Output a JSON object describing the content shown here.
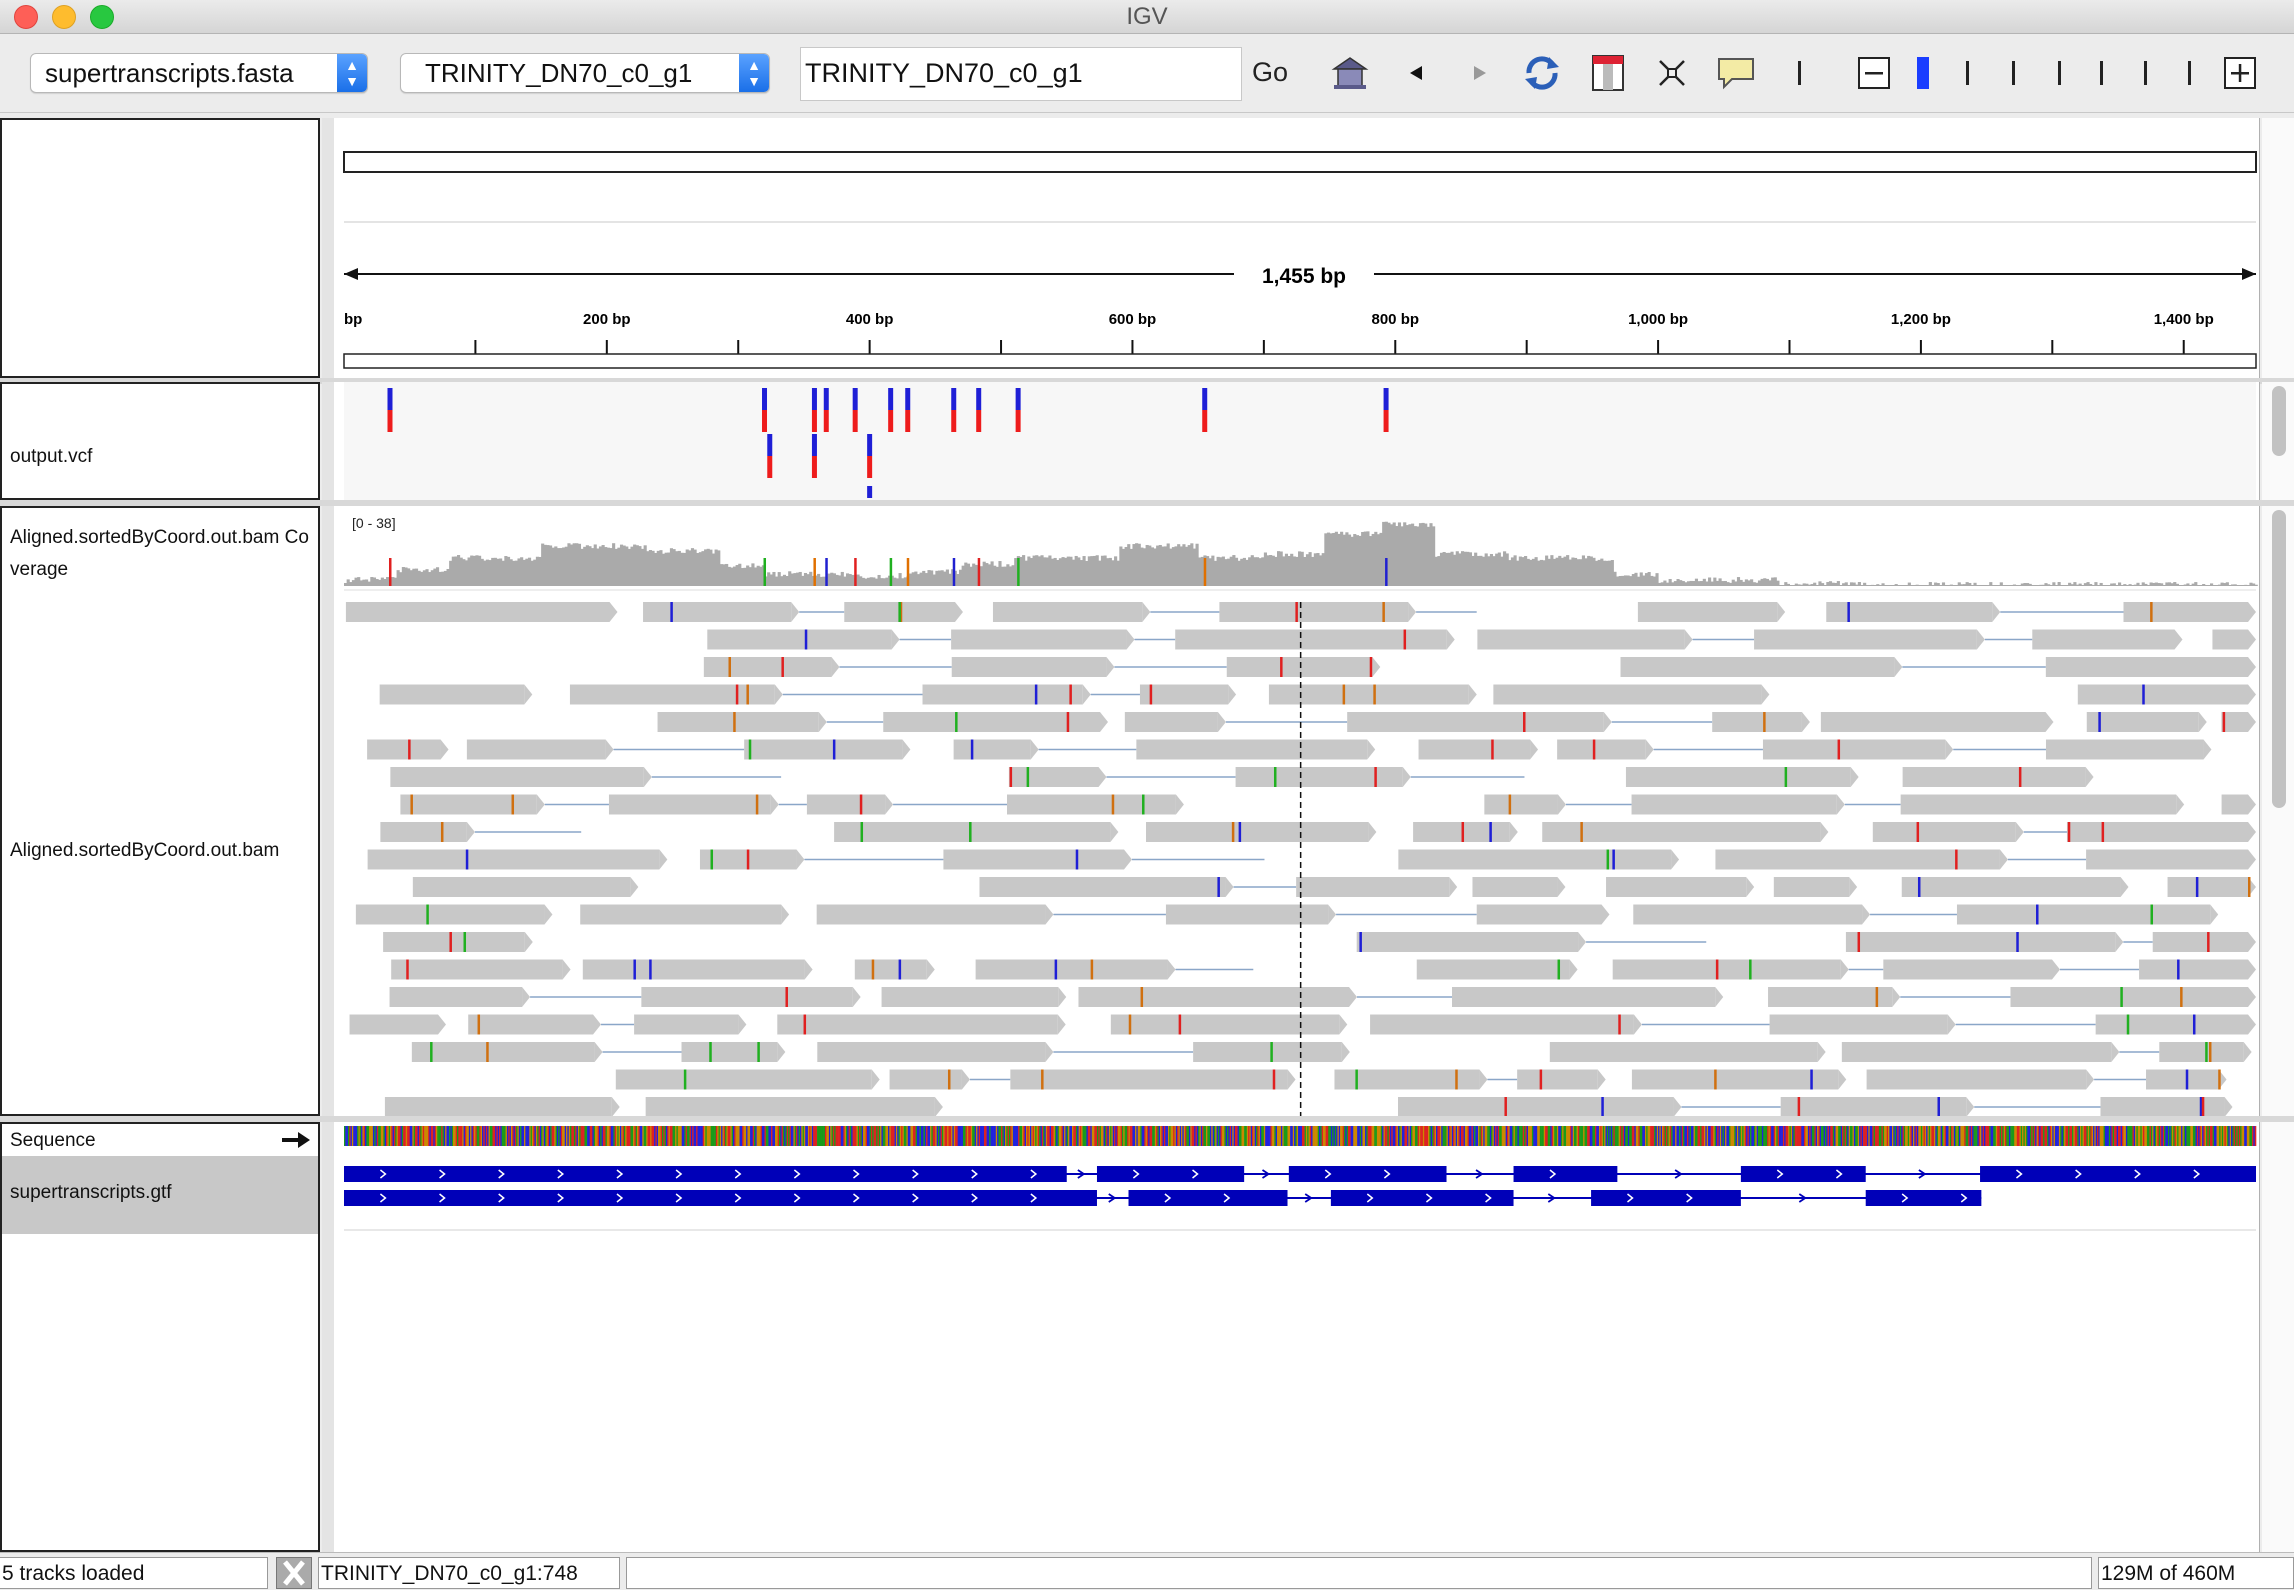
{
  "window": {
    "title": "IGV"
  },
  "toolbar": {
    "genome": "supertranscripts.fasta",
    "chromosome": "TRINITY_DN70_c0_g1",
    "locus": "TRINITY_DN70_c0_g1",
    "go_label": "Go",
    "colors": {
      "zoom_marker": "#1a3dff",
      "accent": "#1a6fe8"
    }
  },
  "ruler": {
    "span_label": "1,455 bp",
    "clipped_left_label": "bp",
    "length_bp": 1455,
    "ticks": [
      {
        "bp": 200,
        "label": "200 bp"
      },
      {
        "bp": 400,
        "label": "400 bp"
      },
      {
        "bp": 600,
        "label": "600 bp"
      },
      {
        "bp": 800,
        "label": "800 bp"
      },
      {
        "bp": 1000,
        "label": "1,000 bp"
      },
      {
        "bp": 1200,
        "label": "1,200 bp"
      },
      {
        "bp": 1400,
        "label": "1,400 bp"
      }
    ]
  },
  "tracks": {
    "vcf": {
      "name": "output.vcf"
    },
    "coverage": {
      "name": "Aligned.sortedByCoord.out.bam Coverage",
      "range_label": "[0 - 38]"
    },
    "alignments": {
      "name": "Aligned.sortedByCoord.out.bam"
    },
    "sequence": {
      "name": "Sequence"
    },
    "gtf": {
      "name": "supertranscripts.gtf"
    }
  },
  "variants_bp": [
    {
      "bp": 35,
      "row": 0
    },
    {
      "bp": 320,
      "row": 0
    },
    {
      "bp": 358,
      "row": 0
    },
    {
      "bp": 367,
      "row": 0
    },
    {
      "bp": 389,
      "row": 0
    },
    {
      "bp": 416,
      "row": 0
    },
    {
      "bp": 429,
      "row": 0
    },
    {
      "bp": 464,
      "row": 0
    },
    {
      "bp": 483,
      "row": 0
    },
    {
      "bp": 513,
      "row": 0
    },
    {
      "bp": 655,
      "row": 0
    },
    {
      "bp": 793,
      "row": 0
    },
    {
      "bp": 324,
      "row": 1
    },
    {
      "bp": 358,
      "row": 1
    },
    {
      "bp": 400,
      "row": 1
    }
  ],
  "status": {
    "tracks_loaded": "5 tracks loaded",
    "position": "TRINITY_DN70_c0_g1:748",
    "memory": "129M of 460M"
  },
  "colors": {
    "read": "#c8c8c8",
    "coverage": "#aaaaaa",
    "feature": "#0000b8",
    "het_top": "#1f1fd6",
    "het_bottom": "#ee1c1c"
  }
}
